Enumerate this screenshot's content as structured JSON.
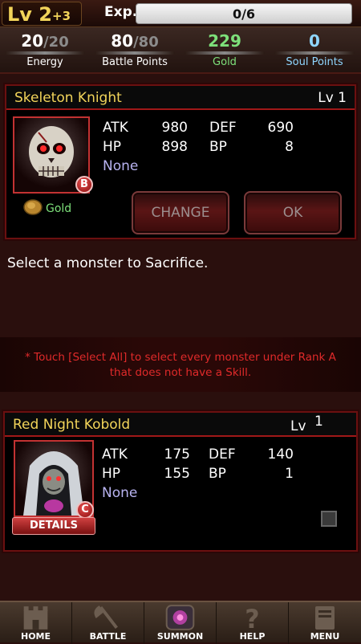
{
  "header": {
    "level": "Lv 2",
    "level_bonus": "+3",
    "exp_label": "Exp.",
    "exp_value": "0/6",
    "exp_progress": 0.0
  },
  "stats": [
    {
      "value": "20",
      "max": "/20",
      "label": "Energy",
      "color": "#ffffff"
    },
    {
      "value": "80",
      "max": "/80",
      "label": "Battle Points",
      "color": "#ffffff"
    },
    {
      "value": "229",
      "max": "",
      "label": "Gold",
      "color": "#7de07a"
    },
    {
      "value": "0",
      "max": "",
      "label": "Soul Points",
      "color": "#8fd6ff"
    }
  ],
  "base_monster": {
    "name": "Skeleton Knight",
    "level": "Lv 1",
    "rank": "B",
    "atk_label": "ATK",
    "atk": "980",
    "def_label": "DEF",
    "def": "690",
    "hp_label": "HP",
    "hp": "898",
    "bp_label": "BP",
    "bp": "8",
    "skill": "None",
    "gold_label": "Gold",
    "change_button": "CHANGE",
    "ok_button": "OK"
  },
  "instruction": "Select a monster to Sacrifice.",
  "notice_line1": "* Touch [Select All] to select every monster under Rank A",
  "notice_line2": "that does not have a Skill.",
  "sacrifice_monster": {
    "name": "Red Night Kobold",
    "level_label": "Lv",
    "level": "1",
    "rank": "C",
    "atk_label": "ATK",
    "atk": "175",
    "def_label": "DEF",
    "def": "140",
    "hp_label": "HP",
    "hp": "155",
    "bp_label": "BP",
    "bp": "1",
    "skill": "None",
    "details_button": "DETAILS",
    "selected": false
  },
  "nav": [
    {
      "label": "HOME",
      "icon": "castle-icon"
    },
    {
      "label": "BATTLE",
      "icon": "axe-icon"
    },
    {
      "label": "SUMMON",
      "icon": "portal-icon"
    },
    {
      "label": "HELP",
      "icon": "question-icon"
    },
    {
      "label": "MENU",
      "icon": "book-icon"
    }
  ]
}
